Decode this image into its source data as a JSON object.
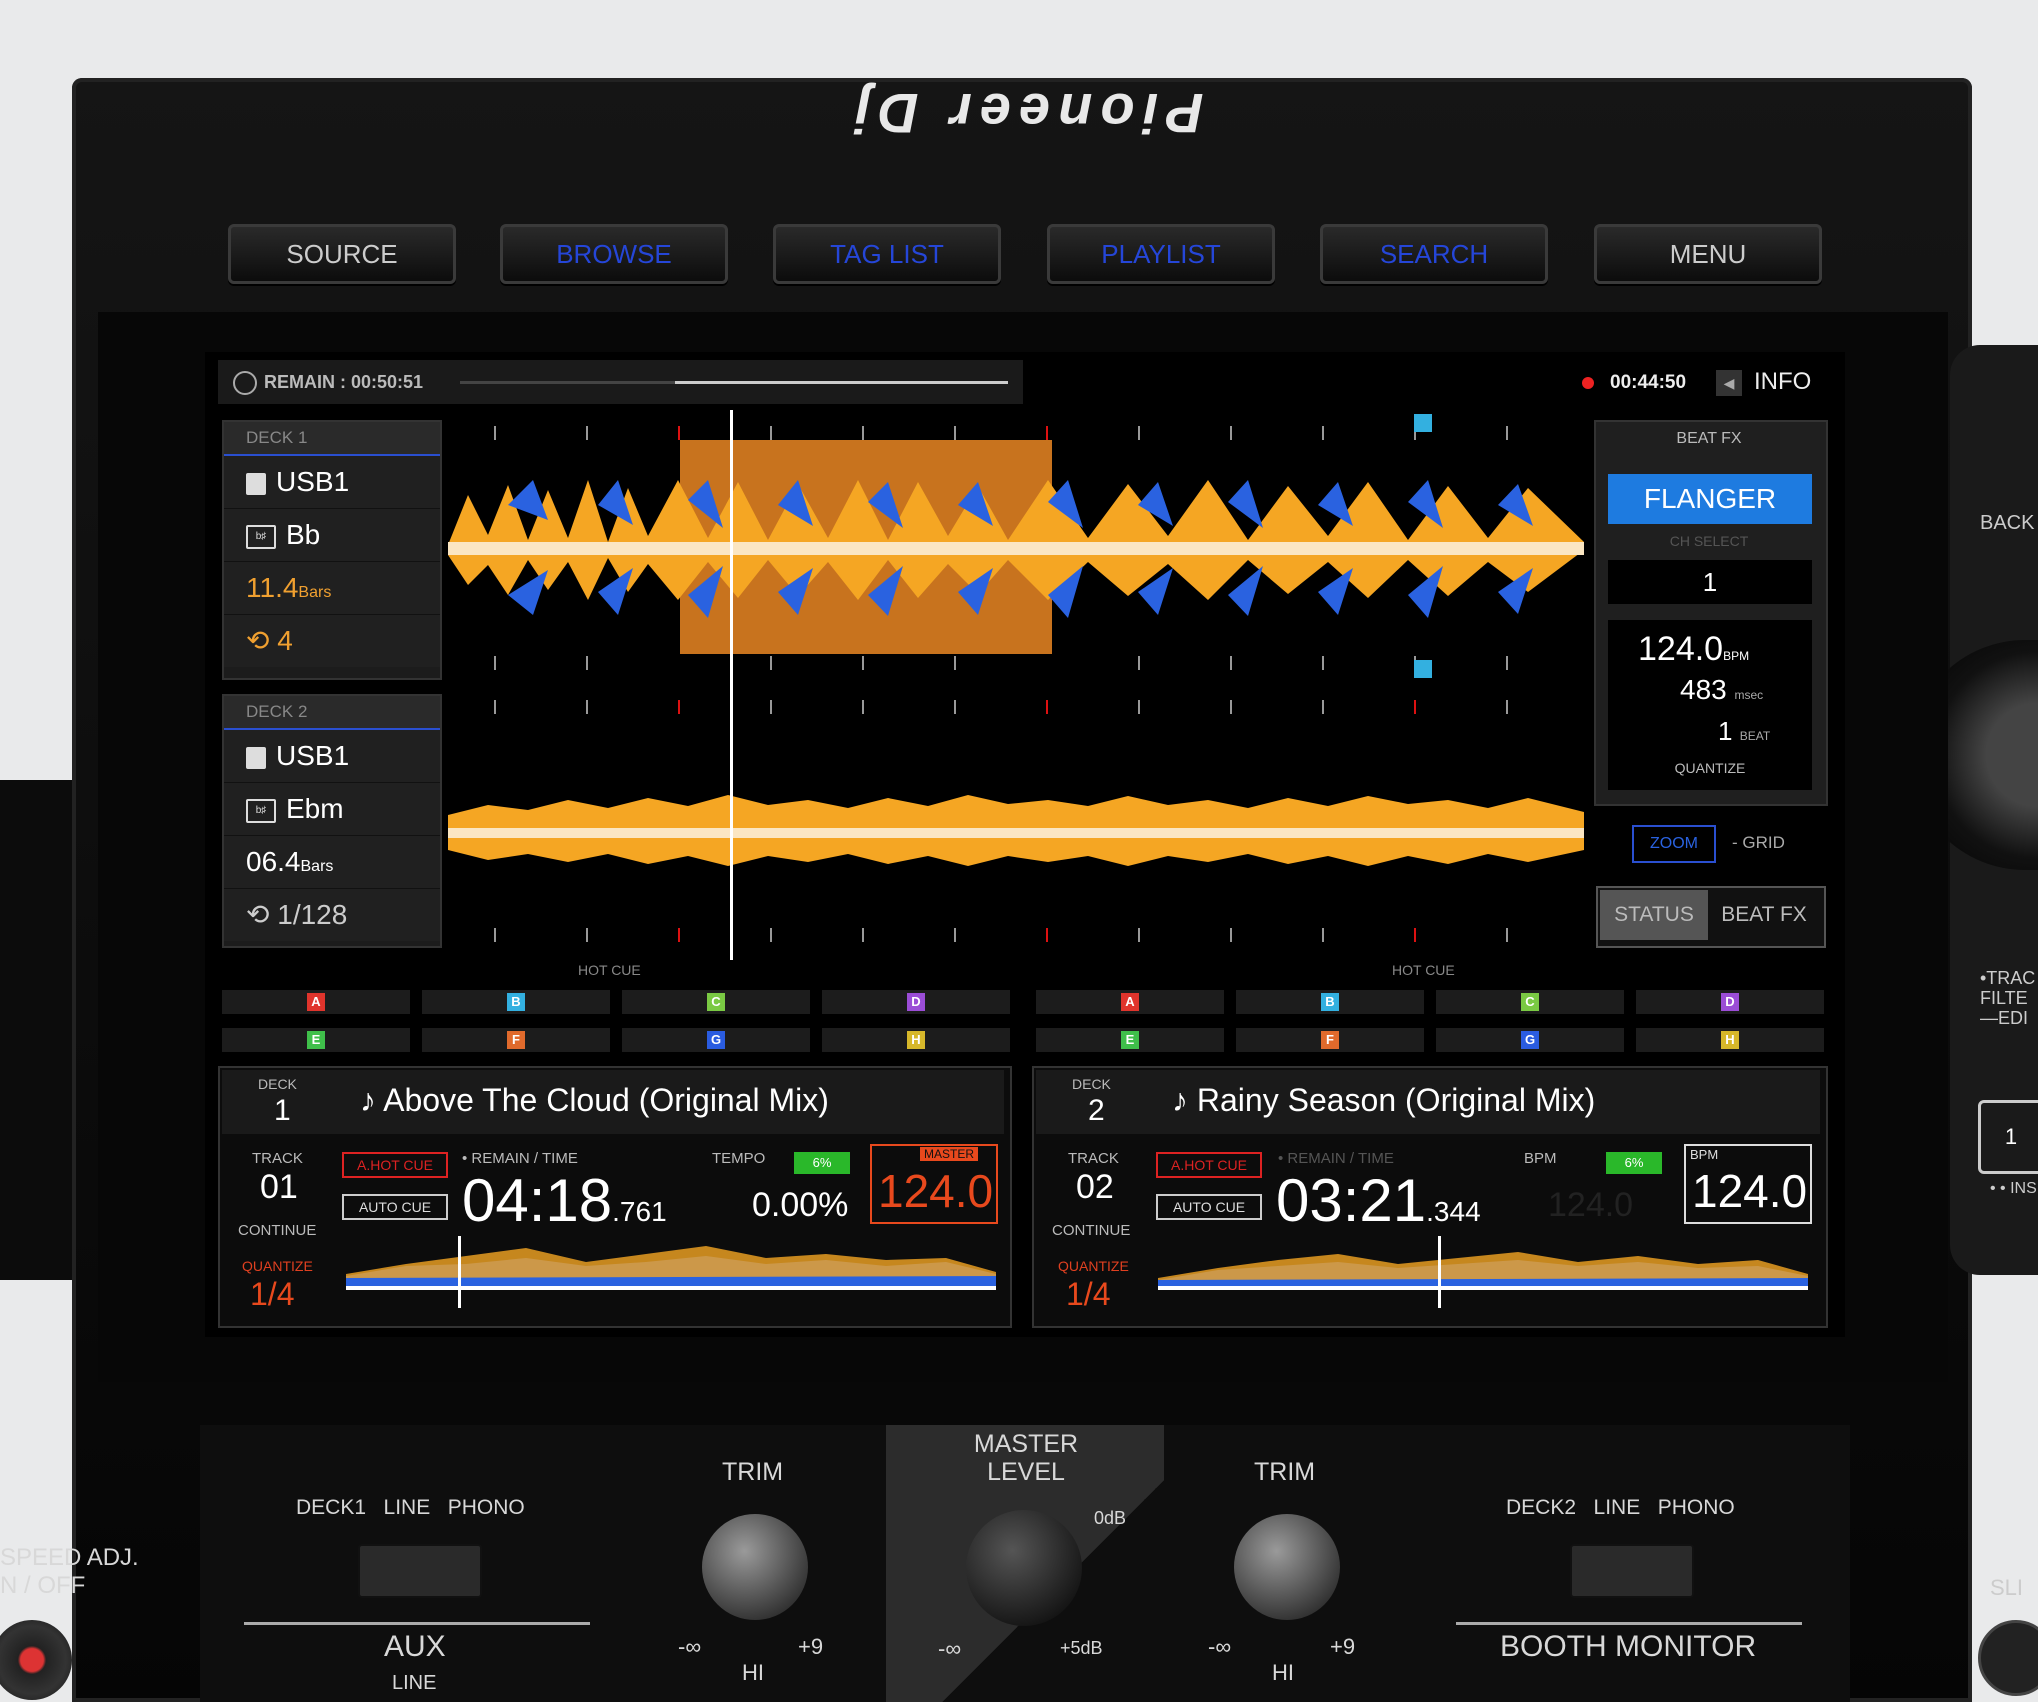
{
  "brand": "Pioneer Dj",
  "hardware_buttons": [
    "SOURCE",
    "BROWSE",
    "TAG LIST",
    "PLAYLIST",
    "SEARCH",
    "MENU"
  ],
  "topbar": {
    "remain": "REMAIN : 00:50:51",
    "clock": "00:44:50",
    "info": "INFO"
  },
  "deck1_panel": {
    "header": "DECK 1",
    "source": "USB1",
    "key": "Bb",
    "bars": "11.4",
    "bars_unit": "Bars",
    "loop": "4"
  },
  "deck2_panel": {
    "header": "DECK 2",
    "source": "USB1",
    "key": "Ebm",
    "bars": "06.4",
    "bars_unit": "Bars",
    "loop": "1/128"
  },
  "beatfx": {
    "header": "BEAT FX",
    "effect": "FLANGER",
    "ch_select_label": "CH SELECT",
    "ch_select": "1",
    "bpm": "124.0",
    "bpm_unit": "BPM",
    "msec": "483",
    "msec_unit": "msec",
    "beat": "1",
    "beat_unit": "BEAT",
    "quantize": "QUANTIZE",
    "zoom": "ZOOM",
    "grid": "- GRID",
    "status": "STATUS",
    "beatfx_tab": "BEAT FX"
  },
  "hot_cue_label": "HOT CUE",
  "hot_cues": [
    {
      "letter": "A",
      "color": "#e0342c"
    },
    {
      "letter": "B",
      "color": "#33b0e0"
    },
    {
      "letter": "C",
      "color": "#7ac943"
    },
    {
      "letter": "D",
      "color": "#9b4dd6"
    },
    {
      "letter": "E",
      "color": "#3fbf4a"
    },
    {
      "letter": "F",
      "color": "#e06a2c"
    },
    {
      "letter": "G",
      "color": "#2a5ce0"
    },
    {
      "letter": "H",
      "color": "#d6b72a"
    }
  ],
  "deck1_info": {
    "deck_label": "DECK",
    "deck_num": "1",
    "title": "♪ Above The Cloud (Original Mix)",
    "track_label": "TRACK",
    "track": "01",
    "continue": "CONTINUE",
    "quantize": "QUANTIZE",
    "quantize_val": "1/4",
    "ahotcue": "A.HOT CUE",
    "autocue": "AUTO CUE",
    "remain_label": "• REMAIN / TIME",
    "time_main": "04:18",
    "time_ms": ".761",
    "tempo_label": "TEMPO",
    "tempo": "0.00%",
    "range": "6%",
    "master": "MASTER",
    "bpm": "124.0"
  },
  "deck2_info": {
    "deck_label": "DECK",
    "deck_num": "2",
    "title": "♪ Rainy Season (Original Mix)",
    "track_label": "TRACK",
    "track": "02",
    "continue": "CONTINUE",
    "quantize": "QUANTIZE",
    "quantize_val": "1/4",
    "ahotcue": "A.HOT CUE",
    "autocue": "AUTO CUE",
    "remain_label": "• REMAIN / TIME",
    "time_main": "03:21",
    "time_ms": ".344",
    "bpm_label": "BPM",
    "ghost_bpm": "124.0",
    "range": "6%",
    "bpm_box_label": "BPM",
    "bpm": "124.0"
  },
  "mixer": {
    "deck1_line_phono": [
      "DECK1",
      "LINE",
      "PHONO"
    ],
    "deck2_line_phono": [
      "DECK2",
      "LINE",
      "PHONO"
    ],
    "trim": "TRIM",
    "master_level": "MASTER LEVEL",
    "zero_db": "0dB",
    "plus5": "+5dB",
    "minus_inf": "-∞",
    "plus9": "+9",
    "hi": "HI",
    "aux": "AUX",
    "aux_sub": "LINE",
    "booth": "BOOTH MONITOR",
    "speed_adj": "SPEED ADJ.",
    "on_off": "N / OFF",
    "side_back": "BACK",
    "side_trac": "•TRAC",
    "side_filte": "FILTE",
    "side_edi": "—EDI",
    "side_1": "1",
    "side_ins": "• • INS",
    "side_sli": "SLI"
  },
  "colors": {
    "accent_blue": "#2a4fd0",
    "wave_orange": "#f5a623",
    "wave_blue": "#2a62e0",
    "loop_orange": "#c8731e",
    "flanger": "#1e7be0",
    "master_red": "#e8491d"
  }
}
